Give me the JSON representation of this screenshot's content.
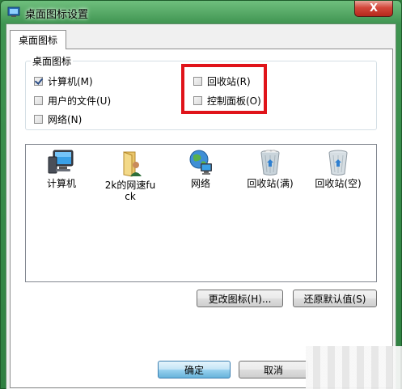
{
  "window": {
    "title": "桌面图标设置",
    "close_glyph": "X"
  },
  "tab": {
    "label": "桌面图标"
  },
  "group": {
    "legend": "桌面图标"
  },
  "checkboxes": [
    {
      "label": "计算机(M)",
      "checked": true
    },
    {
      "label": "用户的文件(U)",
      "checked": false
    },
    {
      "label": "网络(N)",
      "checked": false
    },
    {
      "label": "回收站(R)",
      "checked": false
    },
    {
      "label": "控制面板(O)",
      "checked": false
    }
  ],
  "icons": [
    {
      "label": "计算机",
      "icon": "computer-icon"
    },
    {
      "label": "2k的网速fuck",
      "icon": "user-folder-icon"
    },
    {
      "label": "网络",
      "icon": "network-globe-icon"
    },
    {
      "label": "回收站(满)",
      "icon": "recycle-bin-full-icon"
    },
    {
      "label": "回收站(空)",
      "icon": "recycle-bin-empty-icon"
    }
  ],
  "buttons": {
    "change_icon": "更改图标(H)...",
    "restore_default": "还原默认值(S)",
    "ok": "确定",
    "cancel": "取消"
  },
  "colors": {
    "highlight": "#e0141a",
    "title_bar": "#3f9451"
  }
}
